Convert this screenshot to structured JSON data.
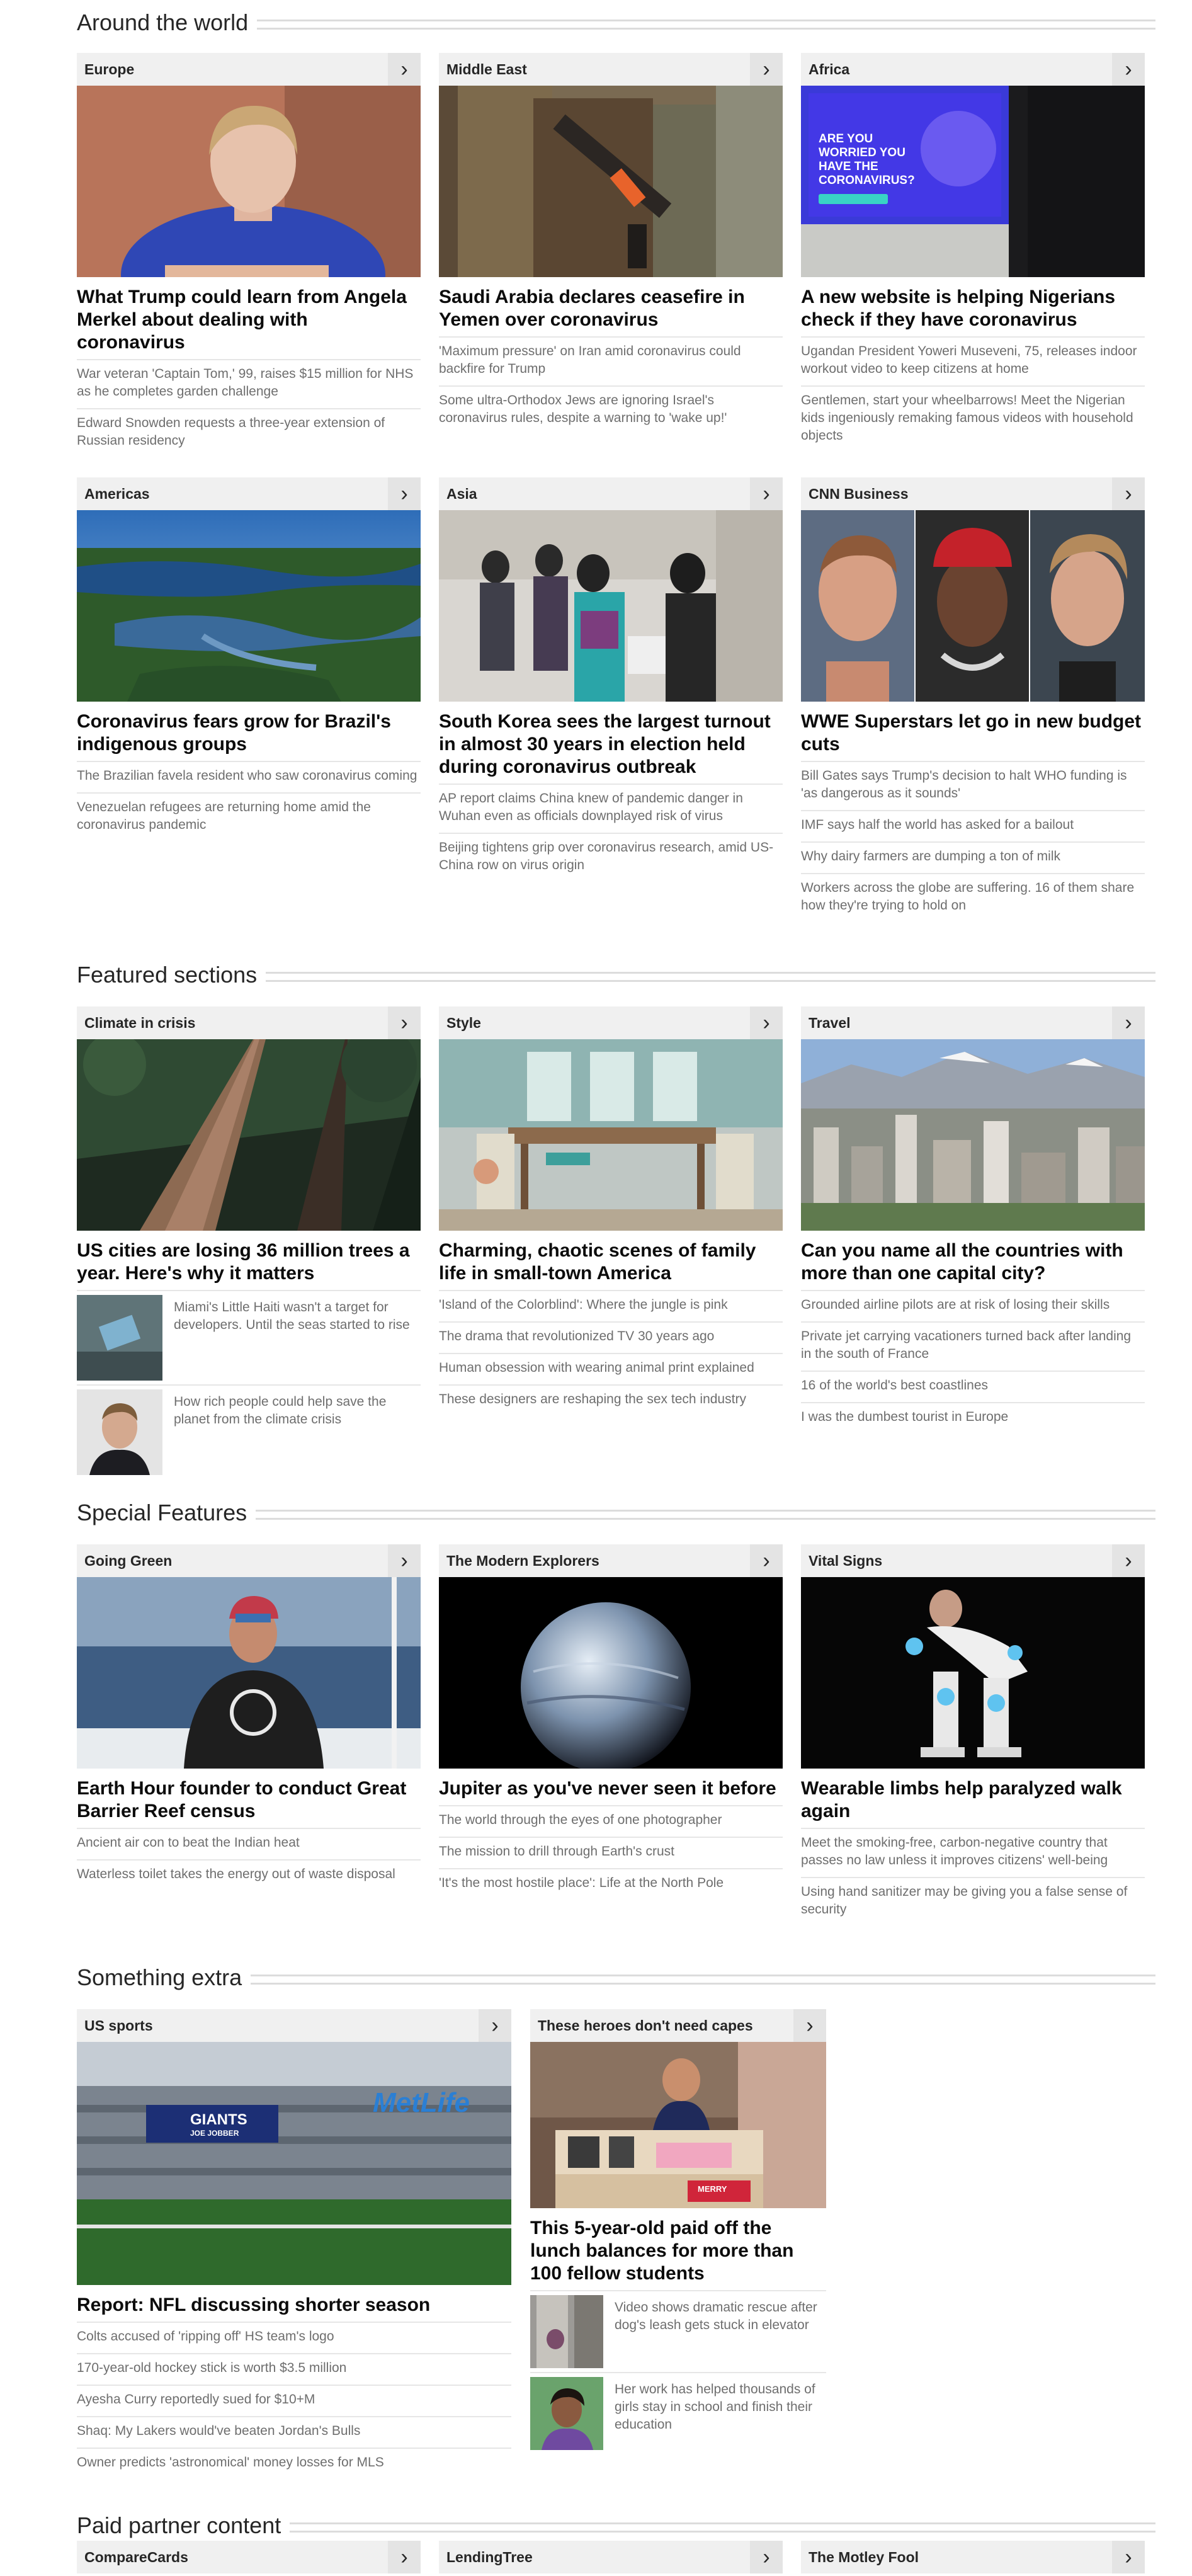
{
  "sections": {
    "around_world": "Around the world",
    "featured": "Featured sections",
    "special": "Special Features",
    "extra": "Something extra",
    "paid": "Paid partner content"
  },
  "chev": "›",
  "cards": {
    "europe": {
      "label": "Europe",
      "headline": "What Trump could learn from Angela Merkel about dealing with coronavirus",
      "links": [
        "War veteran 'Captain Tom,' 99, raises $15 million for NHS as he completes garden challenge",
        "Edward Snowden requests a three-year extension of Russian residency"
      ]
    },
    "middle_east": {
      "label": "Middle East",
      "headline": "Saudi Arabia declares ceasefire in Yemen over coronavirus",
      "links": [
        "'Maximum pressure' on Iran amid coronavirus could backfire for Trump",
        "Some ultra-Orthodox Jews are ignoring Israel's coronavirus rules, despite a warning to 'wake up!'"
      ]
    },
    "africa": {
      "label": "Africa",
      "headline": "A new website is helping Nigerians check if they have coronavirus",
      "links": [
        "Ugandan President Yoweri Museveni, 75, releases indoor workout video to keep citizens at home",
        "Gentlemen, start your wheelbarrows! Meet the Nigerian kids ingeniously remaking famous videos with household objects"
      ],
      "screen_text": "ARE YOU WORRIED YOU HAVE THE CORONAVIRUS?"
    },
    "americas": {
      "label": "Americas",
      "headline": "Coronavirus fears grow for Brazil's indigenous groups",
      "links": [
        "The Brazilian favela resident who saw coronavirus coming",
        "Venezuelan refugees are returning home amid the coronavirus pandemic"
      ]
    },
    "asia": {
      "label": "Asia",
      "headline": "South Korea sees the largest turnout in almost 30 years in election held during coronavirus outbreak",
      "links": [
        "AP report claims China knew of pandemic danger in Wuhan even as officials downplayed risk of virus",
        "Beijing tightens grip over coronavirus research, amid US-China row on virus origin"
      ]
    },
    "cnn_business": {
      "label": "CNN Business",
      "headline": "WWE Superstars let go in new budget cuts",
      "links": [
        "Bill Gates says Trump's decision to halt WHO funding is 'as dangerous as it sounds'",
        "IMF says half the world has asked for a bailout",
        "Why dairy farmers are dumping a ton of milk",
        "Workers across the globe are suffering. 16 of them share how they're trying to hold on"
      ]
    },
    "climate": {
      "label": "Climate in crisis",
      "headline": "US cities are losing 36 million trees a year. Here's why it matters",
      "thumb_links": [
        "Miami's Little Haiti wasn't a target for developers. Until the seas started to rise",
        "How rich people could help save the planet from the climate crisis"
      ]
    },
    "style": {
      "label": "Style",
      "headline": "Charming, chaotic scenes of family life in small-town America",
      "links": [
        "'Island of the Colorblind': Where the jungle is pink",
        "The drama that revolutionized TV 30 years ago",
        "Human obsession with wearing animal print explained",
        "These designers are reshaping the sex tech industry"
      ]
    },
    "travel": {
      "label": "Travel",
      "headline": "Can you name all the countries with more than one capital city?",
      "links": [
        "Grounded airline pilots are at risk of losing their skills",
        "Private jet carrying vacationers turned back after landing in the south of France",
        "16 of the world's best coastlines",
        "I was the dumbest tourist in Europe"
      ]
    },
    "going_green": {
      "label": "Going Green",
      "headline": "Earth Hour founder to conduct Great Barrier Reef census",
      "links": [
        "Ancient air con to beat the Indian heat",
        "Waterless toilet takes the energy out of waste disposal"
      ]
    },
    "modern_explorers": {
      "label": "The Modern Explorers",
      "headline": "Jupiter as you've never seen it before",
      "links": [
        "The world through the eyes of one photographer",
        "The mission to drill through Earth's crust",
        "'It's the most hostile place': Life at the North Pole"
      ]
    },
    "vital_signs": {
      "label": "Vital Signs",
      "headline": "Wearable limbs help paralyzed walk again",
      "links": [
        "Meet the smoking-free, carbon-negative country that passes no law unless it improves citizens' well-being",
        "Using hand sanitizer may be giving you a false sense of security"
      ]
    },
    "us_sports": {
      "label": "US sports",
      "headline": "Report: NFL discussing shorter season",
      "links": [
        "Colts accused of 'ripping off' HS team's logo",
        "170-year-old hockey stick is worth $3.5 million",
        "Ayesha Curry reportedly sued for $10+M",
        "Shaq: My Lakers would've beaten Jordan's Bulls",
        "Owner predicts 'astronomical' money losses for MLS"
      ],
      "stadium_brand": "MetLife",
      "banner_text": "GIANTS",
      "banner_sub": "JOE JOBBER"
    },
    "heroes": {
      "label": "These heroes don't need capes",
      "headline": "This 5-year-old paid off the lunch balances for more than 100 fellow students",
      "thumb_links": [
        "Video shows dramatic rescue after dog's leash gets stuck in elevator",
        "Her work has helped thousands of girls stay in school and finish their education"
      ],
      "sign_text": "MERRY"
    },
    "comparecards": {
      "label": "CompareCards"
    },
    "lendingtree": {
      "label": "LendingTree"
    },
    "motleyfool": {
      "label": "The Motley Fool"
    }
  }
}
